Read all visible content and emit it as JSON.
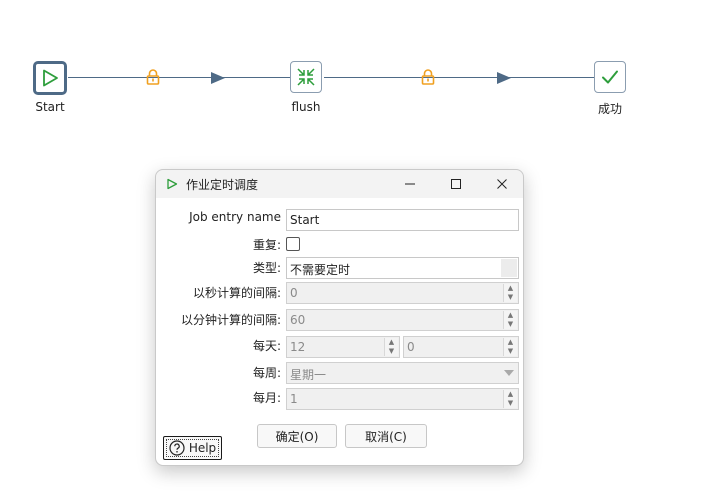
{
  "canvas": {
    "nodes": [
      {
        "label": "Start"
      },
      {
        "label": "flush"
      },
      {
        "label": "成功"
      }
    ]
  },
  "dialog": {
    "title": "作业定时调度",
    "fields": {
      "job_entry_name_label": "Job entry name",
      "job_entry_name_value": "Start",
      "repeat_label": "重复:",
      "type_label": "类型:",
      "type_value": "不需要定时",
      "interval_seconds_label": "以秒计算的间隔:",
      "interval_seconds_value": "0",
      "interval_minutes_label": "以分钟计算的间隔:",
      "interval_minutes_value": "60",
      "daily_label": "每天:",
      "daily_hour_value": "12",
      "daily_minute_value": "0",
      "weekly_label": "每周:",
      "weekly_value": "星期一",
      "monthly_label": "每月:",
      "monthly_value": "1"
    },
    "buttons": {
      "ok": "确定(O)",
      "cancel": "取消(C)",
      "help": "Help"
    }
  },
  "colors": {
    "connector": "#4e6a86",
    "lock": "#f0a020",
    "start_green": "#2e9e3c",
    "success_green": "#2e9e3c"
  }
}
